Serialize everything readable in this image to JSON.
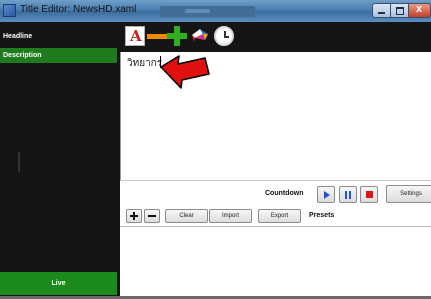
{
  "window": {
    "title": "Title Editor: NewsHD.xaml"
  },
  "sidebar": {
    "items": [
      {
        "label": "Headline"
      },
      {
        "label": "Description"
      }
    ],
    "live_label": "Live"
  },
  "toolbar": {
    "icons": [
      "text-format-icon",
      "remove-icon",
      "add-icon",
      "color-palette-icon",
      "clock-icon"
    ]
  },
  "editor": {
    "text": "วิทยากร"
  },
  "countdown": {
    "label": "Countdown",
    "settings_label": "Settings"
  },
  "presets": {
    "clear_label": "Clear",
    "import_label": "Import",
    "export_label": "Export",
    "label": "Presets"
  },
  "colors": {
    "sidebar_bg": "#151515",
    "selected_item": "#1e7c1e",
    "live_button": "#1d8a1d",
    "arrow": "#e01010"
  }
}
